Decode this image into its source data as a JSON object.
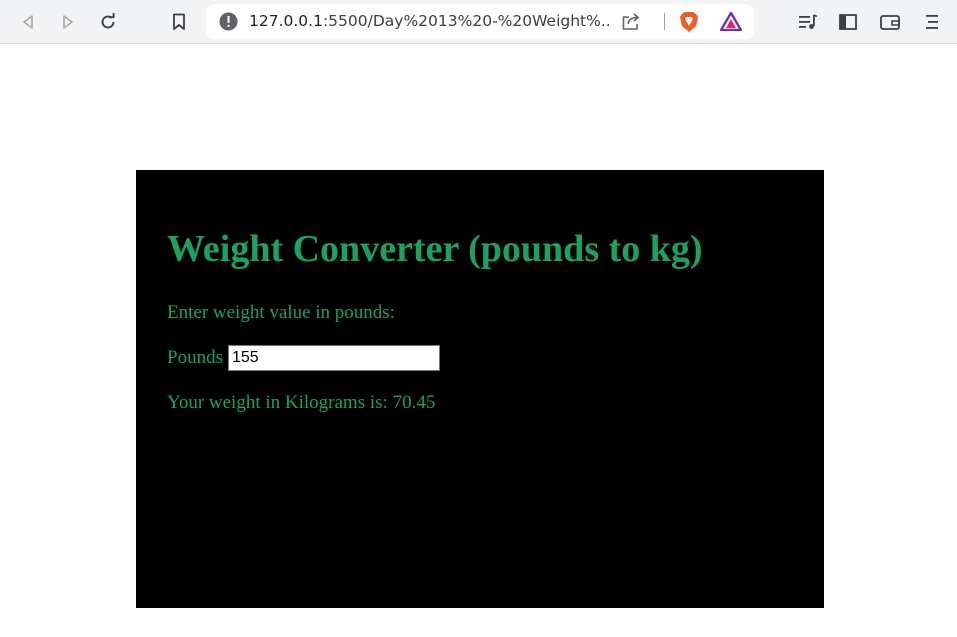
{
  "browser": {
    "url_host": "127.0.0.1",
    "url_rest": ":5500/Day%2013%20-%20Weight%..."
  },
  "app": {
    "title": "Weight Converter (pounds to kg)",
    "prompt": "Enter weight value in pounds:",
    "input_label": "Pounds",
    "input_value": "155",
    "result_prefix": "Your weight in Kilograms is: ",
    "result_value": "70.45"
  },
  "colors": {
    "accent": "#1aa260",
    "app_background": "#000000",
    "toolbar_background": "#f1f3f4"
  }
}
